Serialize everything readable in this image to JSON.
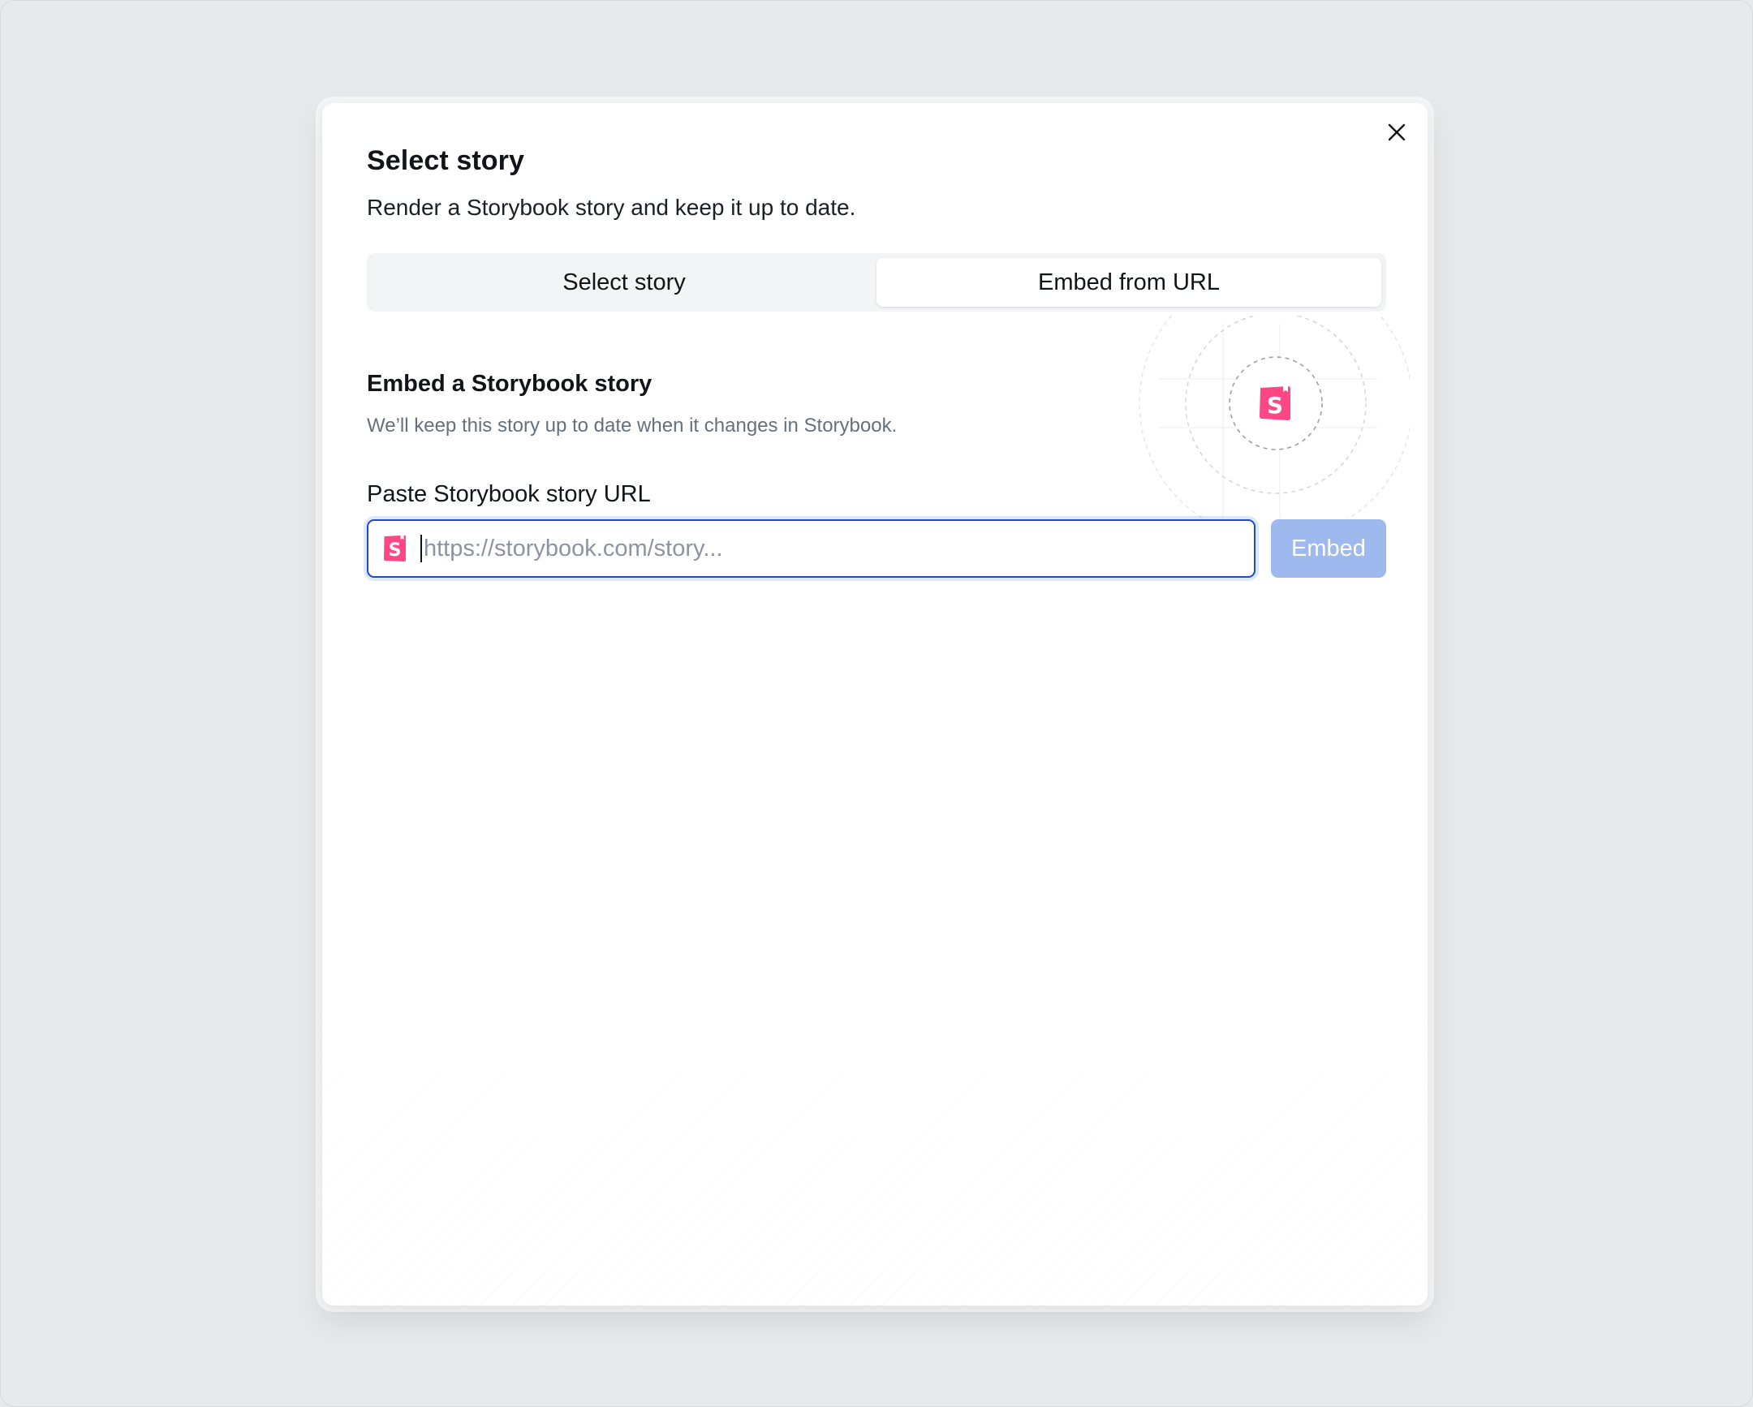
{
  "modal": {
    "title": "Select story",
    "subtitle": "Render a Storybook story and keep it up to date."
  },
  "tabs": [
    {
      "label": "Select story",
      "active": false
    },
    {
      "label": "Embed from URL",
      "active": true
    }
  ],
  "embed_section": {
    "title": "Embed a Storybook story",
    "description": "We’ll keep this story up to date when it changes in Storybook."
  },
  "url_field": {
    "label": "Paste Storybook story URL",
    "value": "",
    "placeholder": "https://storybook.com/story..."
  },
  "embed_button": {
    "label": "Embed",
    "disabled": true
  },
  "icons": {
    "close": "close-icon",
    "storybook": "storybook-logo-icon"
  },
  "colors": {
    "storybook_pink": "#ff4785",
    "focus_border": "#1f4bbf",
    "embed_button_disabled": "#9db9ee",
    "overlay_background": "#e8e9eb"
  }
}
